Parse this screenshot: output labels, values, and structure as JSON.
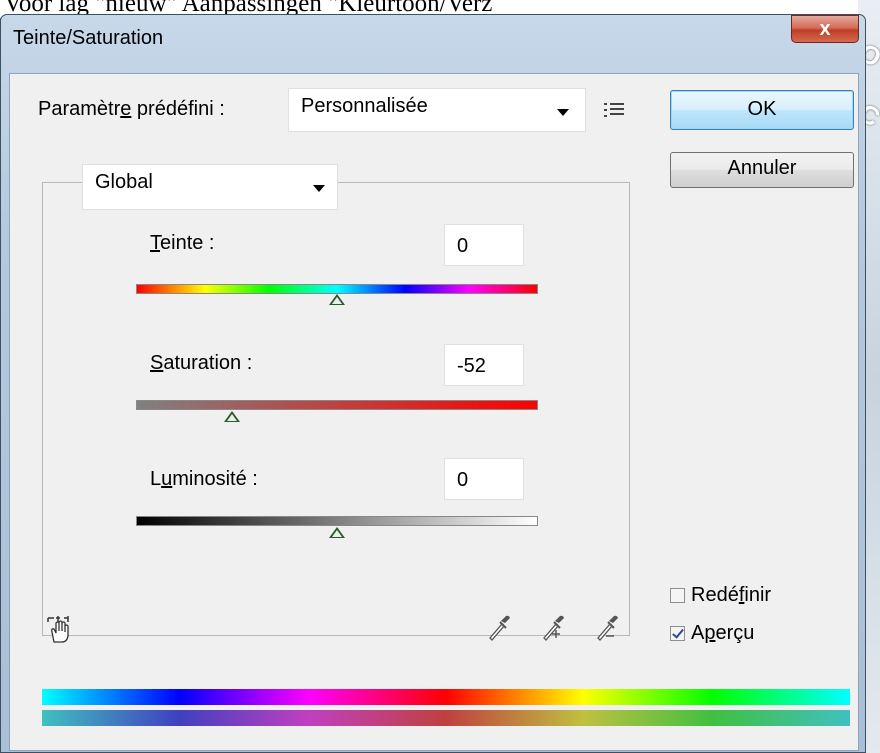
{
  "background": {
    "top_text": "Voor lag \"nieuw\" Aanpassingen \"Kleurtoon/Verz",
    "right_glyphs": [
      "O",
      "C"
    ]
  },
  "window": {
    "title": "Teinte/Saturation",
    "close_label": "x"
  },
  "preset": {
    "label_before": "Paramètr",
    "label_mnemonic": "e",
    "label_after": " prédéfini :",
    "value": "Personnalisée",
    "options_icon": "list-options-icon"
  },
  "buttons": {
    "ok": "OK",
    "cancel": "Annuler"
  },
  "channel": {
    "value": "Global"
  },
  "hue": {
    "label_mnemonic": "T",
    "label_rest": "einte :",
    "value": "0",
    "slider_fraction": 0.5
  },
  "saturation": {
    "label_mnemonic": "S",
    "label_rest": "aturation :",
    "value": "-52",
    "slider_fraction": 0.24
  },
  "lightness": {
    "label_before": "L",
    "label_mnemonic": "u",
    "label_rest": "minosité :",
    "value": "0",
    "slider_fraction": 0.5
  },
  "tools": {
    "hand": "hand-adjust-icon",
    "droppers": [
      "eyedropper-icon",
      "eyedropper-plus-icon",
      "eyedropper-minus-icon"
    ]
  },
  "options": {
    "colorize": {
      "label_before": "Redé",
      "label_mnemonic": "f",
      "label_after": "inir",
      "checked": false
    },
    "preview": {
      "label_before": "A",
      "label_mnemonic": "p",
      "label_after": "erçu",
      "checked": true
    }
  }
}
